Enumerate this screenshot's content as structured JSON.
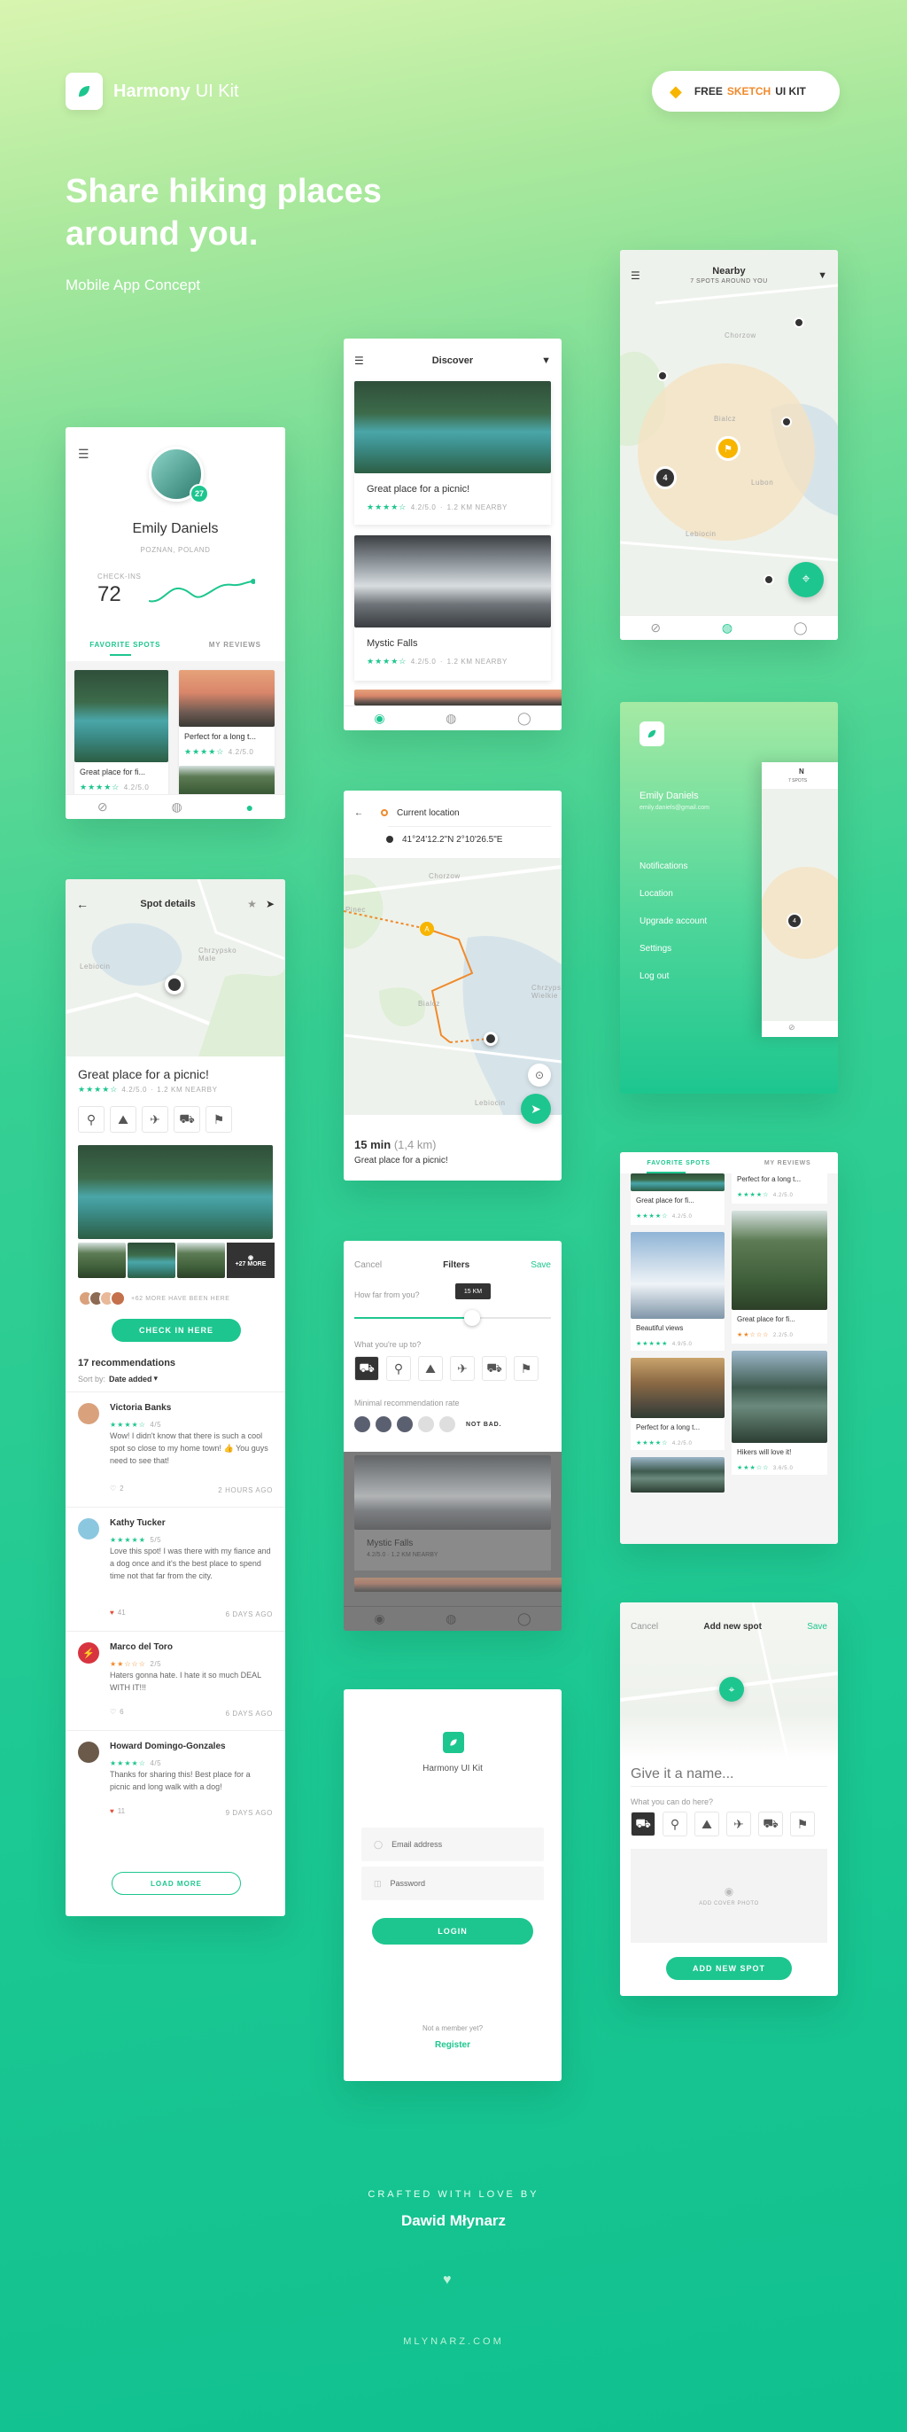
{
  "brand": {
    "name": "Harmony",
    "name_suffix": "UI Kit"
  },
  "badge": {
    "free": "FREE",
    "sketch": "SKETCH",
    "uikit": "UI KIT"
  },
  "hero": {
    "title_line1": "Share hiking places",
    "title_line2": "around you.",
    "subtitle": "Mobile App Concept"
  },
  "profile": {
    "avatar_badge": "27",
    "name": "Emily Daniels",
    "location": "POZNAN, POLAND",
    "checkins_label": "CHECK-INS",
    "checkins_value": "72",
    "tabs": [
      "FAVORITE SPOTS",
      "MY REVIEWS"
    ],
    "cards": [
      {
        "title": "Great place for fi...",
        "rating": "4.2/5.0"
      },
      {
        "title": "Perfect for a long t...",
        "rating": "4.2/5.0"
      }
    ]
  },
  "discover": {
    "title": "Discover",
    "cards": [
      {
        "title": "Great place for a picnic!",
        "rating": "4.2/5.0",
        "distance": "1.2 KM NEARBY"
      },
      {
        "title": "Mystic Falls",
        "rating": "4.2/5.0",
        "distance": "1.2 KM NEARBY"
      }
    ]
  },
  "nearby": {
    "title": "Nearby",
    "subtitle": "7 SPOTS AROUND YOU",
    "cluster": "4",
    "places": [
      "Chorzow",
      "Bialcz",
      "Lubon",
      "Lebiocin"
    ]
  },
  "menu": {
    "name": "Emily Daniels",
    "email": "emily.daniels@gmail.com",
    "items": [
      "Notifications",
      "Location",
      "Upgrade account",
      "Settings",
      "Log out"
    ],
    "peek_title": "N",
    "peek_sub": "7 SPOTS",
    "peek_cluster": "4"
  },
  "spot": {
    "header": "Spot details",
    "map_labels": [
      "Lebiocin",
      "Chrzypsko Male"
    ],
    "title": "Great place for a picnic!",
    "rating": "4.2/5.0",
    "distance": "1.2 KM NEARBY",
    "more_photos": "+27 MORE",
    "been_here": "+62 MORE HAVE BEEN HERE",
    "checkin_label": "CHECK IN HERE",
    "recommendations": "17 recommendations",
    "sort_label": "Sort by:",
    "sort_value": "Date added",
    "reviews": [
      {
        "name": "Victoria Banks",
        "rating": "4/5",
        "text": "Wow! I didn't know that there is such a cool spot so close to my home town! 👍 You guys need to see that!",
        "likes": "2",
        "time": "2 HOURS AGO"
      },
      {
        "name": "Kathy Tucker",
        "rating": "5/5",
        "text": "Love this spot! I was there with my fiance and a dog once and it's the best place to spend time not that far from the city.",
        "likes": "41",
        "time": "6 DAYS AGO"
      },
      {
        "name": "Marco del Toro",
        "rating": "2/5",
        "text": "Haters gonna hate. I hate it so much DEAL WITH IT!!!",
        "likes": "6",
        "time": "6 DAYS AGO"
      },
      {
        "name": "Howard Domingo-Gonzales",
        "rating": "4/5",
        "text": "Thanks for sharing this! Best place for a picnic and long walk with a dog!",
        "likes": "11",
        "time": "9 DAYS AGO"
      }
    ],
    "load_more": "LOAD MORE"
  },
  "route": {
    "from": "Current location",
    "to": "41°24'12.2\"N 2°10'26.5\"E",
    "map_labels": [
      "Chorzow",
      "Pinec",
      "Bialcz",
      "Chrzypsko Wielkie",
      "Lebiocin"
    ],
    "marker": "A",
    "time": "15 min",
    "distance": "(1,4 km)",
    "dest": "Great place for a picnic!"
  },
  "filters": {
    "cancel": "Cancel",
    "title": "Filters",
    "save": "Save",
    "how_far": "How far from you?",
    "km_badge": "15 KM",
    "slider_level": 0.6,
    "up_to": "What you're up to?",
    "min_rate": "Minimal recommendation rate",
    "rate_hint": "NOT BAD.",
    "rate_value": 3,
    "bg_card_title": "Mystic Falls",
    "bg_card_meta": "4.2/5.0 · 1.2 KM NEARBY"
  },
  "login": {
    "brand": "Harmony UI Kit",
    "email": "Email address",
    "password": "Password",
    "login": "LOGIN",
    "not_member": "Not a member yet?",
    "register": "Register"
  },
  "favorites": {
    "tabs": [
      "FAVORITE SPOTS",
      "MY REVIEWS"
    ],
    "col1": [
      {
        "title": "Great place for fi...",
        "rating": "4.2/5.0"
      },
      {
        "title": "Beautiful views",
        "rating": "4.9/5.0"
      },
      {
        "title": "Perfect for a long t...",
        "rating": "4.2/5.0"
      }
    ],
    "col2": [
      {
        "title": "Perfect for a long t...",
        "rating": "4.2/5.0"
      },
      {
        "title": "Great place for fi...",
        "rating": "2.2/5.0"
      },
      {
        "title": "Hikers will love it!",
        "rating": "3.6/5.0"
      }
    ]
  },
  "add_spot": {
    "cancel": "Cancel",
    "title": "Add new spot",
    "save": "Save",
    "name_placeholder": "Give it a name...",
    "can_do": "What you can do here?",
    "add_photo": "ADD COVER PHOTO",
    "add_button": "ADD NEW SPOT"
  },
  "footer": {
    "crafted": "CRAFTED WITH LOVE BY",
    "author": "Dawid Młynarz",
    "site": "MLYNARZ.COM"
  },
  "colors": {
    "accent": "#1dc68f",
    "route": "#f08a2b",
    "text": "#333333"
  }
}
